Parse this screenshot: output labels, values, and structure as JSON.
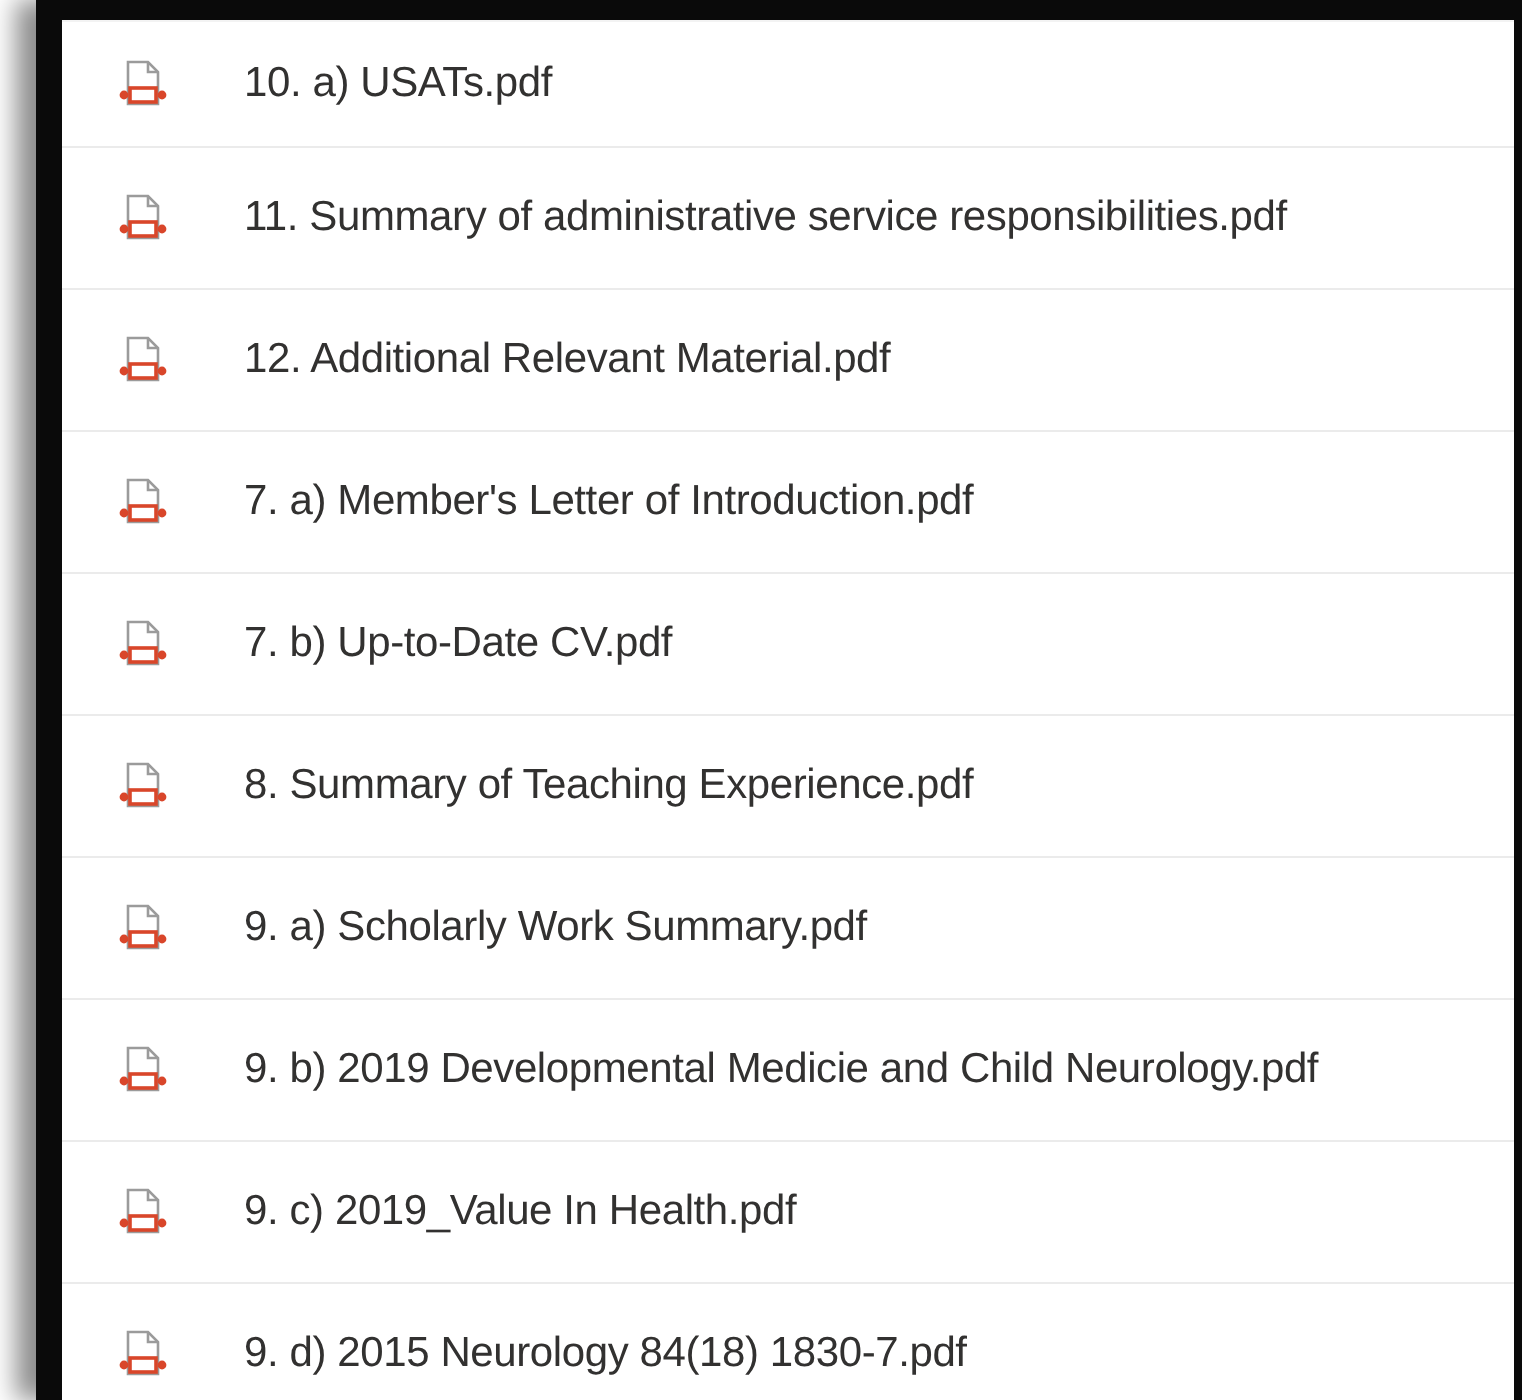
{
  "files": [
    {
      "name": "10. a) USATs.pdf"
    },
    {
      "name": "11. Summary of administrative service responsibilities.pdf"
    },
    {
      "name": "12. Additional Relevant Material.pdf"
    },
    {
      "name": "7. a) Member's Letter of Introduction.pdf"
    },
    {
      "name": "7. b) Up-to-Date CV.pdf"
    },
    {
      "name": "8. Summary of Teaching Experience.pdf"
    },
    {
      "name": "9. a) Scholarly Work Summary.pdf"
    },
    {
      "name": "9. b) 2019 Developmental Medicie and Child Neurology.pdf"
    },
    {
      "name": "9. c) 2019_Value In Health.pdf"
    },
    {
      "name": "9. d) 2015 Neurology 84(18) 1830-7.pdf"
    }
  ]
}
